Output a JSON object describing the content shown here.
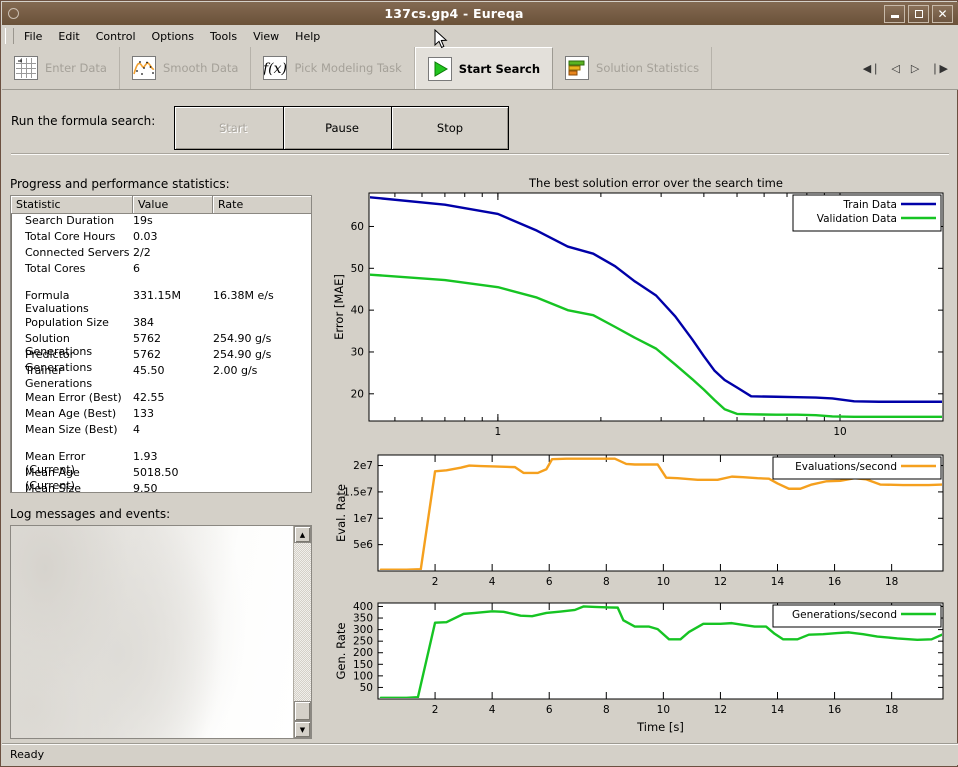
{
  "window": {
    "title": "137cs.gp4 - Eureqa",
    "icon": "window-menu-icon",
    "minimize_label": "Minimize",
    "maximize_label": "Maximize",
    "close_label": "Close"
  },
  "menu": {
    "items": [
      "File",
      "Edit",
      "Control",
      "Options",
      "Tools",
      "View",
      "Help"
    ]
  },
  "toolbar": {
    "buttons": [
      {
        "label": "Enter Data",
        "icon": "grid-table-icon",
        "active": false,
        "enabled": false
      },
      {
        "label": "Smooth Data",
        "icon": "curve-plot-icon",
        "active": false,
        "enabled": false
      },
      {
        "label": "Pick Modeling Task",
        "icon": "function-fx-icon",
        "active": false,
        "enabled": false
      },
      {
        "label": "Start Search",
        "icon": "green-play-icon",
        "active": true,
        "enabled": true
      },
      {
        "label": "Solution Statistics",
        "icon": "bar-chart-icon",
        "active": false,
        "enabled": false
      }
    ],
    "nav": [
      "first",
      "previous",
      "next",
      "last"
    ]
  },
  "run_controls": {
    "label": "Run the formula search:",
    "start": "Start",
    "pause": "Pause",
    "stop": "Stop",
    "start_disabled": true
  },
  "stats_panel": {
    "title": "Progress and performance statistics:",
    "columns": [
      "Statistic",
      "Value",
      "Rate"
    ],
    "rows": [
      {
        "statistic": "Search Duration",
        "value": "19s",
        "rate": ""
      },
      {
        "statistic": "Total Core Hours",
        "value": "0.03",
        "rate": ""
      },
      {
        "statistic": "Connected Servers",
        "value": "2/2",
        "rate": ""
      },
      {
        "statistic": "Total Cores",
        "value": "6",
        "rate": ""
      },
      {
        "spacer": true
      },
      {
        "statistic": "Formula Evaluations",
        "value": "331.15M",
        "rate": "16.38M e/s"
      },
      {
        "spacer": true
      },
      {
        "statistic": "Population Size",
        "value": "384",
        "rate": ""
      },
      {
        "statistic": "Solution Generations",
        "value": "5762",
        "rate": "254.90  g/s"
      },
      {
        "statistic": "Predictor Generations",
        "value": "5762",
        "rate": "254.90  g/s"
      },
      {
        "statistic": "Trainer Generations",
        "value": "45.50",
        "rate": "2.00  g/s"
      },
      {
        "spacer": true
      },
      {
        "statistic": "Mean Error (Best)",
        "value": "42.55",
        "rate": ""
      },
      {
        "statistic": "Mean Age (Best)",
        "value": "133",
        "rate": ""
      },
      {
        "statistic": "Mean Size (Best)",
        "value": "4",
        "rate": ""
      },
      {
        "spacer": true
      },
      {
        "statistic": "Mean Error (Current)",
        "value": "1.93",
        "rate": ""
      },
      {
        "statistic": "Mean Age (Current)",
        "value": "5018.50",
        "rate": ""
      },
      {
        "statistic": "Mean Size (Current)",
        "value": "9.50",
        "rate": ""
      }
    ]
  },
  "log_panel": {
    "title": "Log messages and events:",
    "content": ""
  },
  "status_bar": {
    "text": "Ready"
  },
  "colors": {
    "train": "#0000a8",
    "validation": "#16c423",
    "eval_rate": "#f5a01e",
    "gen_rate": "#16c423",
    "window_chrome": "#d4d0c8",
    "titlebar": "#7a6048"
  },
  "chart_data": [
    {
      "type": "line",
      "name": "best-solution-error-chart",
      "title": "The best solution error over the search time",
      "xlabel": "",
      "ylabel": "Error [MAE]",
      "xscale": "log",
      "xlim": [
        0.42,
        20
      ],
      "ylim": [
        13.5,
        68
      ],
      "xticks": [
        1,
        10
      ],
      "xticklabels": [
        "1",
        "10"
      ],
      "yticks": [
        20,
        30,
        40,
        50,
        60
      ],
      "yticklabels": [
        "20",
        "30",
        "40",
        "50",
        "60"
      ],
      "grid": false,
      "legend_position": "top-right",
      "series": [
        {
          "name": "Train Data",
          "color": "#0000a8",
          "x": [
            0.42,
            0.7,
            1.0,
            1.3,
            1.6,
            1.9,
            2.2,
            2.5,
            2.9,
            3.3,
            3.7,
            4.0,
            4.3,
            4.6,
            5.0,
            5.5,
            6.5,
            7.5,
            8.5,
            9.5,
            11,
            13,
            15,
            17,
            20
          ],
          "y": [
            67.0,
            65.2,
            63.0,
            59.0,
            55.2,
            53.5,
            50.5,
            47.0,
            43.5,
            38.5,
            33.0,
            29.0,
            25.5,
            23.3,
            21.5,
            19.4,
            19.3,
            19.2,
            19.1,
            18.9,
            18.2,
            18.1,
            18.1,
            18.1,
            18.1
          ]
        },
        {
          "name": "Validation Data",
          "color": "#16c423",
          "x": [
            0.42,
            0.7,
            1.0,
            1.3,
            1.6,
            1.9,
            2.2,
            2.5,
            2.9,
            3.3,
            3.7,
            4.0,
            4.3,
            4.6,
            5.0,
            5.5,
            6.5,
            7.5,
            8.5,
            9.5,
            11,
            13,
            15,
            17,
            20
          ],
          "y": [
            48.5,
            47.2,
            45.5,
            43.0,
            40.0,
            38.8,
            36.0,
            33.5,
            30.8,
            27.0,
            23.5,
            21.0,
            18.5,
            16.3,
            15.2,
            15.1,
            15.0,
            15.0,
            14.9,
            14.6,
            14.5,
            14.5,
            14.5,
            14.5,
            14.5
          ]
        }
      ]
    },
    {
      "type": "line",
      "name": "evaluations-per-second-chart",
      "title": "",
      "xlabel": "",
      "ylabel": "Eval. Rate",
      "xscale": "linear",
      "xlim": [
        0,
        19.8
      ],
      "ylim": [
        0,
        22000000
      ],
      "xticks": [
        2,
        4,
        6,
        8,
        10,
        12,
        14,
        16,
        18
      ],
      "xticklabels": [
        "2",
        "4",
        "6",
        "8",
        "10",
        "12",
        "14",
        "16",
        "18"
      ],
      "yticks": [
        5000000,
        10000000,
        15000000,
        20000000
      ],
      "yticklabels": [
        "5e6",
        "1e7",
        "1.5e7",
        "2e7"
      ],
      "grid": false,
      "legend_position": "top-right",
      "series": [
        {
          "name": "Evaluations/second",
          "color": "#f5a01e",
          "x": [
            0.1,
            1.0,
            1.5,
            2.0,
            2.4,
            2.9,
            3.2,
            3.6,
            4.2,
            4.8,
            5.1,
            5.6,
            5.9,
            6.1,
            6.6,
            7.4,
            8.3,
            8.7,
            9.0,
            9.4,
            9.8,
            10.1,
            10.5,
            11.2,
            11.9,
            12.4,
            12.8,
            13.3,
            13.7,
            14.0,
            14.4,
            14.8,
            15.2,
            15.7,
            16.2,
            16.7,
            17.1,
            17.6,
            18.4,
            19.3,
            19.8
          ],
          "y": [
            250000,
            250000,
            350000,
            18900000,
            19100000,
            19600000,
            20000000,
            19900000,
            19800000,
            19700000,
            18600000,
            18600000,
            19300000,
            21200000,
            21300000,
            21300000,
            21300000,
            20300000,
            20200000,
            20200000,
            20200000,
            17700000,
            17600000,
            17300000,
            17300000,
            17900000,
            17800000,
            17600000,
            17500000,
            16600000,
            15600000,
            15600000,
            16400000,
            17000000,
            17100000,
            17600000,
            17400000,
            16400000,
            16300000,
            16300000,
            16400000
          ]
        }
      ]
    },
    {
      "type": "line",
      "name": "generations-per-second-chart",
      "title": "",
      "xlabel": "Time [s]",
      "ylabel": "Gen. Rate",
      "xscale": "linear",
      "xlim": [
        0,
        19.8
      ],
      "ylim": [
        0,
        415
      ],
      "xticks": [
        2,
        4,
        6,
        8,
        10,
        12,
        14,
        16,
        18
      ],
      "xticklabels": [
        "2",
        "4",
        "6",
        "8",
        "10",
        "12",
        "14",
        "16",
        "18"
      ],
      "yticks": [
        50,
        100,
        150,
        200,
        250,
        300,
        350,
        400
      ],
      "yticklabels": [
        "50",
        "100",
        "150",
        "200",
        "250",
        "300",
        "350",
        "400"
      ],
      "grid": false,
      "legend_position": "top-right",
      "series": [
        {
          "name": "Generations/second",
          "color": "#16c423",
          "x": [
            0.1,
            1.0,
            1.4,
            2.0,
            2.4,
            3.0,
            3.4,
            4.0,
            4.4,
            5.0,
            5.4,
            5.9,
            6.4,
            6.9,
            7.2,
            7.6,
            8.1,
            8.4,
            8.6,
            9.0,
            9.5,
            9.8,
            10.2,
            10.6,
            10.9,
            11.4,
            12.0,
            12.4,
            12.8,
            13.2,
            13.6,
            13.9,
            14.2,
            14.7,
            15.1,
            15.6,
            16.1,
            16.5,
            17.0,
            17.5,
            18.2,
            18.9,
            19.4,
            19.8
          ],
          "y": [
            5,
            5,
            8,
            330,
            332,
            368,
            372,
            379,
            377,
            360,
            358,
            372,
            378,
            385,
            400,
            398,
            396,
            395,
            340,
            313,
            313,
            302,
            258,
            258,
            290,
            325,
            325,
            328,
            320,
            313,
            313,
            282,
            258,
            258,
            278,
            280,
            285,
            288,
            280,
            270,
            262,
            256,
            258,
            280
          ]
        }
      ]
    }
  ]
}
